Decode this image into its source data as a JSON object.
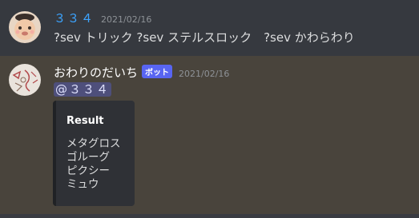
{
  "messages": [
    {
      "author": "３３４",
      "timestamp": "2021/02/16",
      "content": "?sev トリック ?sev ステルスロック　?sev かわらわり"
    },
    {
      "author": "おわりのだいち",
      "bot_tag": "ボット",
      "timestamp": "2021/02/16",
      "mention": "@３３４",
      "embed": {
        "title": "Result",
        "lines": [
          "メタグロス",
          "ゴルーグ",
          "ピクシー",
          "ミュウ"
        ]
      }
    }
  ],
  "colors": {
    "background": "#36393f",
    "highlight_background": "#49443c",
    "username_blue": "#3ca4ff",
    "bot_tag": "#5865f2",
    "embed_background": "#2f3136"
  },
  "icons": {
    "avatar1": "cat-avatar",
    "avatar2": "sketch-avatar"
  }
}
